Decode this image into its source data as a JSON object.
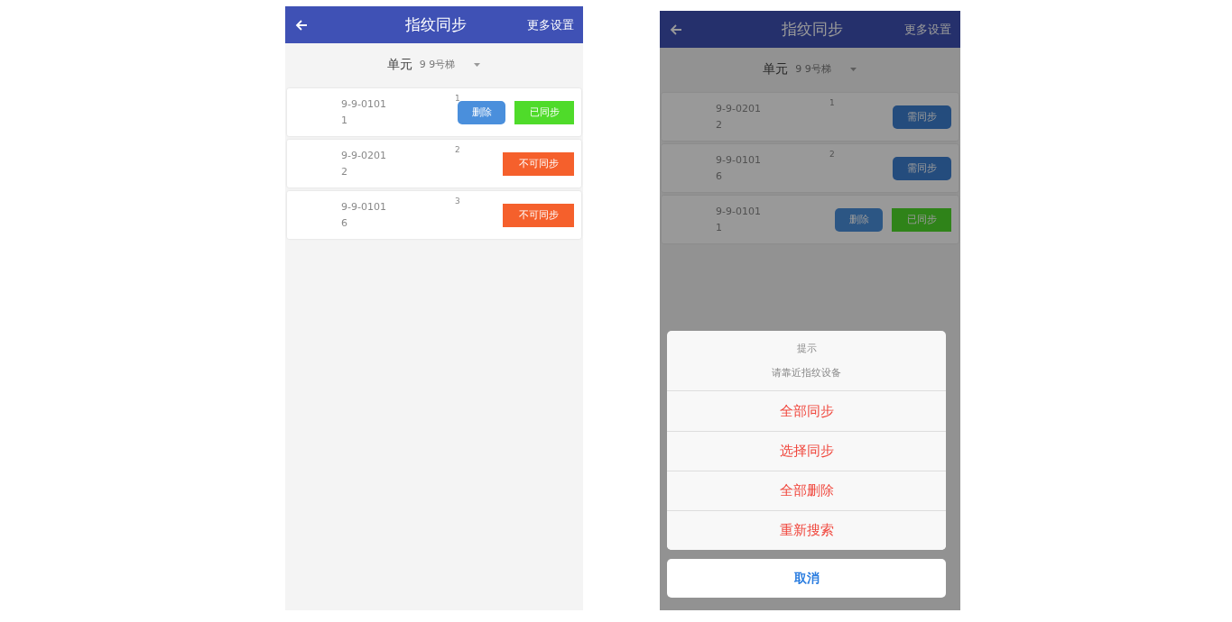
{
  "screens": [
    {
      "dimmed": false,
      "header": {
        "title": "指纹同步",
        "action": "更多设置"
      },
      "unit": {
        "label": "单元",
        "value": "9 9号梯"
      },
      "rows": [
        {
          "code": "9-9-0101",
          "count": "1",
          "index": "1",
          "buttons": [
            {
              "kind": "delete",
              "label": "删除"
            },
            {
              "kind": "synced",
              "label": "已同步"
            }
          ]
        },
        {
          "code": "9-9-0201",
          "count": "2",
          "index": "2",
          "buttons": [
            {
              "kind": "unsyncable",
              "label": "不可同步"
            }
          ]
        },
        {
          "code": "9-9-0101",
          "count": "6",
          "index": "3",
          "buttons": [
            {
              "kind": "unsyncable",
              "label": "不可同步"
            }
          ]
        }
      ]
    },
    {
      "dimmed": true,
      "header": {
        "title": "指纹同步",
        "action": "更多设置"
      },
      "unit": {
        "label": "单元",
        "value": "9 9号梯"
      },
      "rows": [
        {
          "code": "9-9-0201",
          "count": "2",
          "index": "1",
          "buttons": [
            {
              "kind": "pending",
              "label": "需同步"
            }
          ]
        },
        {
          "code": "9-9-0101",
          "count": "6",
          "index": "2",
          "buttons": [
            {
              "kind": "pending",
              "label": "需同步"
            }
          ]
        },
        {
          "code": "9-9-0101",
          "count": "1",
          "buttons": [
            {
              "kind": "delete",
              "label": "删除"
            },
            {
              "kind": "synced",
              "label": "已同步"
            }
          ]
        }
      ],
      "sheet": {
        "title": "提示",
        "message": "请靠近指纹设备",
        "options": [
          "全部同步",
          "选择同步",
          "全部删除",
          "重新搜索"
        ],
        "cancel": "取消"
      }
    }
  ]
}
